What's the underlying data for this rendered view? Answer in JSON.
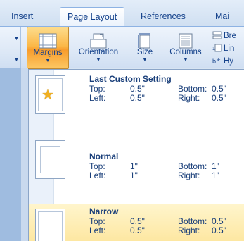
{
  "tabs": [
    {
      "label": "Insert",
      "active": false
    },
    {
      "label": "Page Layout",
      "active": true
    },
    {
      "label": "References",
      "active": false
    },
    {
      "label": "Mai",
      "active": false
    }
  ],
  "ribbon": {
    "margins_label": "Margins",
    "orientation_label": "Orientation",
    "size_label": "Size",
    "columns_label": "Columns",
    "breaks_label": "Bre",
    "line_numbers_label": "Lin",
    "hyphenation_label": "Hy",
    "dropdown_glyph": "▼"
  },
  "margin_presets": [
    {
      "name": "Last Custom Setting",
      "top_label": "Top:",
      "top": "0.5\"",
      "bottom_label": "Bottom:",
      "bottom": "0.5\"",
      "left_label": "Left:",
      "left": "0.5\"",
      "right_label": "Right:",
      "right": "0.5\"",
      "icon": "star-icon"
    },
    {
      "name": "Normal",
      "top_label": "Top:",
      "top": "1\"",
      "bottom_label": "Bottom:",
      "bottom": "1\"",
      "left_label": "Left:",
      "left": "1\"",
      "right_label": "Right:",
      "right": "1\""
    },
    {
      "name": "Narrow",
      "top_label": "Top:",
      "top": "0.5\"",
      "bottom_label": "Bottom:",
      "bottom": "0.5\"",
      "left_label": "Left:",
      "left": "0.5\"",
      "right_label": "Right:",
      "right": "0.5\"",
      "highlighted": true
    }
  ],
  "colors": {
    "accent_text": "#15428b",
    "pressed_orange": "#fbb848",
    "highlight": "#fde7a1"
  }
}
